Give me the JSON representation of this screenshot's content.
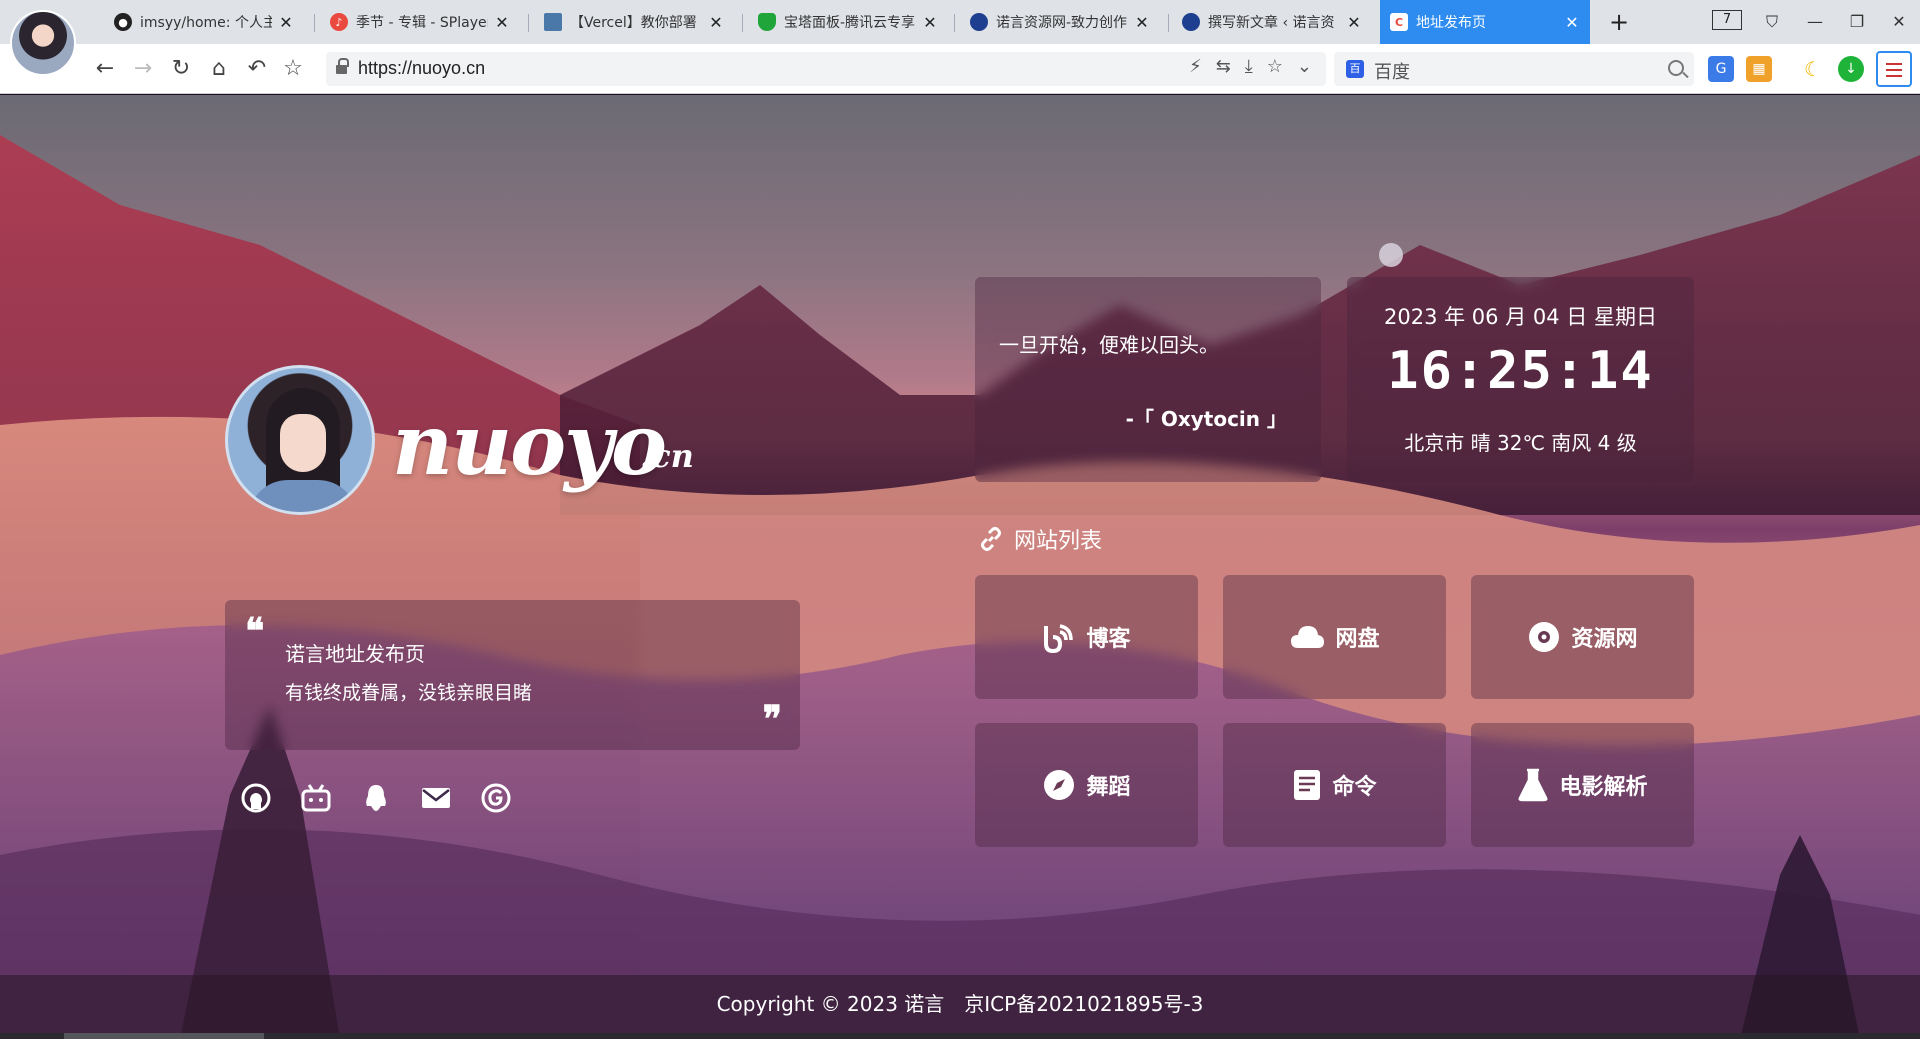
{
  "browser": {
    "tabs": [
      {
        "title": "imsyy/home: 个人主页",
        "icon": "github-icon",
        "active": false
      },
      {
        "title": "季节 - 专辑 - SPlayer",
        "icon": "music-icon",
        "active": false
      },
      {
        "title": "【Vercel】教你部署",
        "icon": "image-icon",
        "active": false
      },
      {
        "title": "宝塔面板-腾讯云专享",
        "icon": "shield-icon",
        "active": false
      },
      {
        "title": "诺言资源网-致力创作",
        "icon": "site-icon",
        "active": false
      },
      {
        "title": "撰写新文章 ‹ 诺言资",
        "icon": "site-icon",
        "active": false
      },
      {
        "title": "地址发布页",
        "icon": "c-icon",
        "active": true
      }
    ],
    "tab_count": "7",
    "url": "https://nuoyo.cn",
    "search_placeholder": "百度"
  },
  "page": {
    "logo": "nuoyo",
    "logo_suffix": ".cn",
    "intro": {
      "title": "诺言地址发布页",
      "text": "有钱终成眷属，没钱亲眼目睹"
    },
    "social_icons": [
      "github-icon",
      "bilibili-icon",
      "qq-icon",
      "mail-icon",
      "g-icon"
    ],
    "hitokoto": {
      "text": "一旦开始，便难以回头。",
      "from": "-「 Oxytocin 」"
    },
    "clock": {
      "date": "2023 年 06 月 04 日 星期日",
      "time": "16:25:14",
      "weather": "北京市 晴 32℃ 南风 4 级"
    },
    "section_title": "网站列表",
    "sites": [
      {
        "label": "博客",
        "icon": "blog-icon"
      },
      {
        "label": "网盘",
        "icon": "cloud-icon"
      },
      {
        "label": "资源网",
        "icon": "disc-icon"
      },
      {
        "label": "舞蹈",
        "icon": "compass-icon"
      },
      {
        "label": "命令",
        "icon": "book-icon"
      },
      {
        "label": "电影解析",
        "icon": "flask-icon"
      }
    ],
    "footer": "Copyright © 2023 诺言　京ICP备2021021895号-3"
  }
}
